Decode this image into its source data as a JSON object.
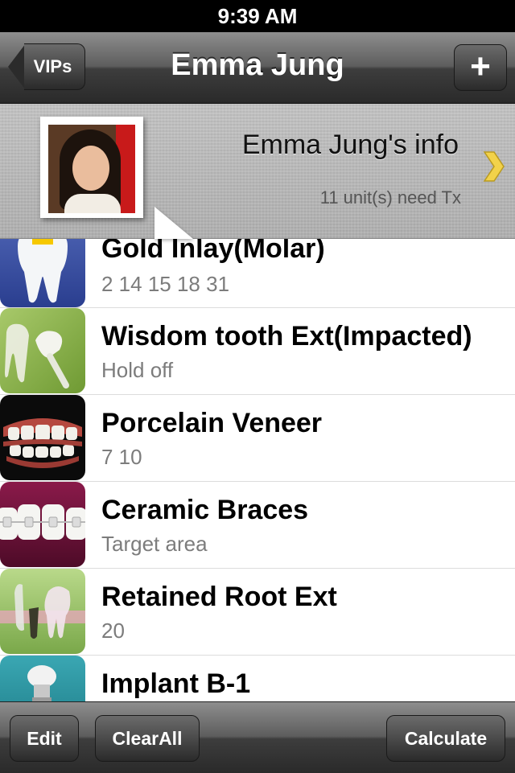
{
  "status_bar": {
    "time": "9:39 AM"
  },
  "navbar": {
    "title": "Emma Jung",
    "back_label": "VIPs",
    "add_label": "+"
  },
  "info": {
    "title": "Emma Jung's info",
    "subtitle": "11 unit(s) need Tx"
  },
  "treatments": [
    {
      "title": "Gold Inlay(Molar)",
      "detail": "2 14 15 18 31",
      "icon": "gold-inlay-molar-image"
    },
    {
      "title": "Wisdom tooth Ext(Impacted)",
      "detail": "Hold off",
      "icon": "wisdom-tooth-image"
    },
    {
      "title": "Porcelain Veneer",
      "detail": "7 10",
      "icon": "porcelain-veneer-image"
    },
    {
      "title": "Ceramic Braces",
      "detail": "Target area",
      "icon": "ceramic-braces-image"
    },
    {
      "title": "Retained Root Ext",
      "detail": "20",
      "icon": "retained-root-image"
    },
    {
      "title": "Implant B-1",
      "detail": "",
      "icon": "implant-image"
    }
  ],
  "toolbar": {
    "edit_label": "Edit",
    "clear_label": "ClearAll",
    "calculate_label": "Calculate"
  },
  "colors": {
    "bar_dark": "#2a2a2a",
    "chevron": "#f2d24a",
    "subtitle_gray": "#7c7c7c"
  }
}
